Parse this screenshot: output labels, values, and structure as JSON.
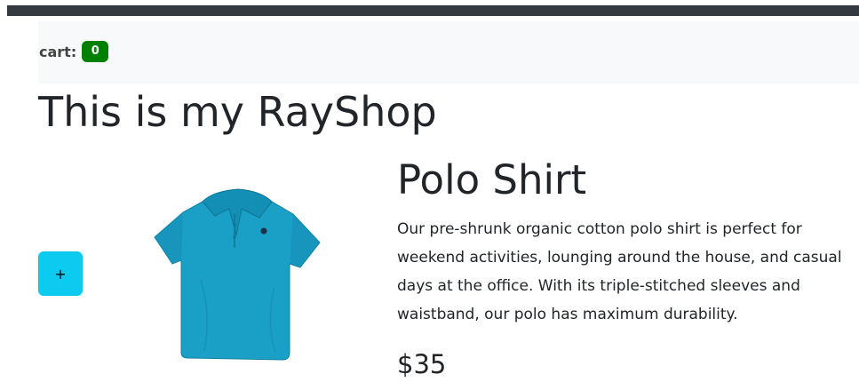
{
  "navbar": {
    "cart_label": "cart:",
    "cart_count": "0"
  },
  "page": {
    "title": "This is my RayShop"
  },
  "product": {
    "add_label": "+",
    "name": "Polo Shirt",
    "description": "Our pre-shrunk organic cotton polo shirt is perfect for weekend activities, lounging around the house, and casual days at the office. With its triple-stitched sleeves and waistband, our polo has maximum durability.",
    "price": "$35",
    "image_icon": "polo-shirt-icon",
    "shirt_color": "#1a9fc7"
  },
  "colors": {
    "badge": "#008000",
    "add_button": "#0dcaf0",
    "top_bar": "#343a40",
    "navbar_bg": "#f8f9fa"
  }
}
